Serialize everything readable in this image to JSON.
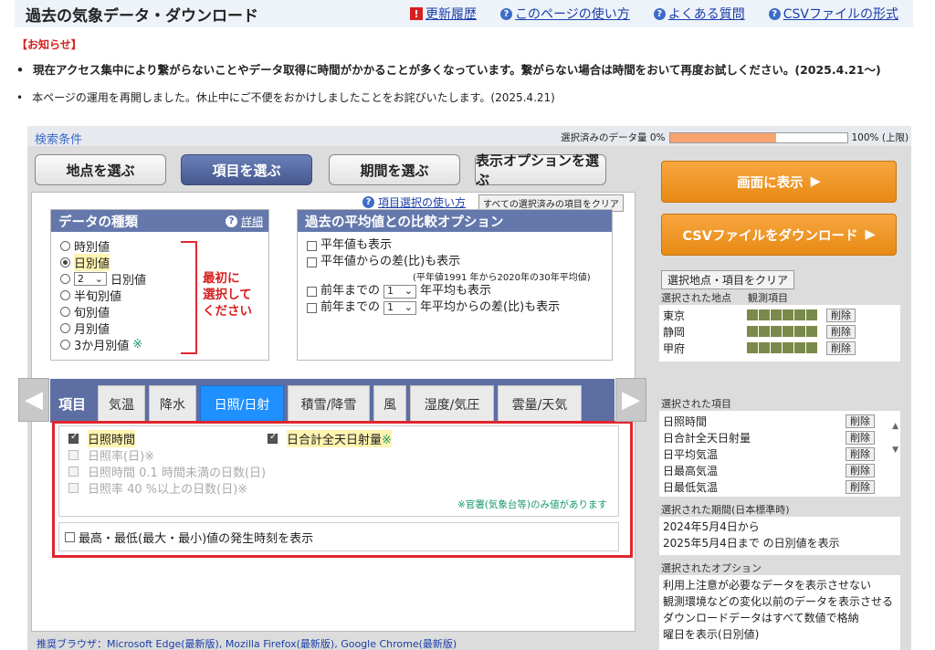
{
  "header": {
    "title": "過去の気象データ・ダウンロード",
    "links": [
      "更新履歴",
      "このページの使い方",
      "よくある質問",
      "CSVファイルの形式"
    ]
  },
  "notice": {
    "title": "【お知らせ】",
    "line1": "現在アクセス集中により繋がらないことやデータ取得に時間がかかることが多くなっています。繋がらない場合は時間をおいて再度お試しください。(2025.4.21〜)",
    "line2": "本ページの運用を再開しました。休止中にご不便をおかけしましたことをお詫びいたします。(2025.4.21)"
  },
  "panel": {
    "title": "検索条件",
    "amount_label": "選択済みのデータ量 0%",
    "amount_max": "100% (上限)",
    "amount_fill": 0.6
  },
  "tabs": [
    "地点を選ぶ",
    "項目を選ぶ",
    "期間を選ぶ",
    "表示オプションを選ぶ"
  ],
  "usage_link": "項目選択の使い方",
  "clear_all": "すべての選択済みの項目をクリア",
  "data_type": {
    "title": "データの種類",
    "detail": "詳細",
    "options": [
      "時別値",
      "日別値",
      "日別値",
      "半旬別値",
      "旬別値",
      "月別値",
      "3か月別値"
    ],
    "select_value": "2",
    "note": "最初に 選択して ください",
    "note_lines": [
      "最初に",
      "選択して",
      "ください"
    ],
    "star": "※"
  },
  "compare": {
    "title": "過去の平均値との比較オプション",
    "opt1": "平年値も表示",
    "opt2": "平年値からの差(比)も表示",
    "opt2_note": "(平年値1991 年から2020年の30年平均値)",
    "opt3_pre": "前年までの",
    "opt3_post": "年平均も表示",
    "opt4_pre": "前年までの",
    "opt4_post": "年平均からの差(比)も表示",
    "select_value": "1"
  },
  "category_tabs": [
    "項目",
    "気温",
    "降水",
    "日照/日射",
    "積雪/降雪",
    "風",
    "湿度/気圧",
    "雲量/天気"
  ],
  "items": {
    "checked1": "日照時間",
    "checked2": "日合計全天日射量",
    "star": "※",
    "disabled": [
      "日照率(日)※",
      "日照時間 0.1 時間未満の日数(日)",
      "日照率 40 %以上の日数(日)※"
    ],
    "note": "※官署(気象台等)のみ値があります"
  },
  "time_option": "最高・最低(最大・最小)値の発生時刻を表示",
  "right": {
    "show_button": "画面に表示",
    "csv_button": "CSVファイルをダウンロード",
    "clear_button": "選択地点・項目をクリア",
    "stations_label": "選択された地点",
    "elements_label": "観測項目",
    "stations": [
      "東京",
      "静岡",
      "甲府"
    ],
    "delete": "削除",
    "items_label": "選択された項目",
    "selected_items": [
      "日照時間",
      "日合計全天日射量",
      "日平均気温",
      "日最高気温",
      "日最低気温"
    ],
    "period_label": "選択された期間(日本標準時)",
    "period_from": "2024年5月4日から",
    "period_to": "2025年5月4日まで の日別値を表示",
    "options_label": "選択されたオプション",
    "options": [
      "利用上注意が必要なデータを表示させない",
      "観測環境などの変化以前のデータを表示させる",
      "ダウンロードデータはすべて数値で格納",
      "曜日を表示(日別値)"
    ]
  },
  "footer": "推奨ブラウザ：Microsoft Edge(最新版), Mozilla Firefox(最新版), Google Chrome(最新版)"
}
